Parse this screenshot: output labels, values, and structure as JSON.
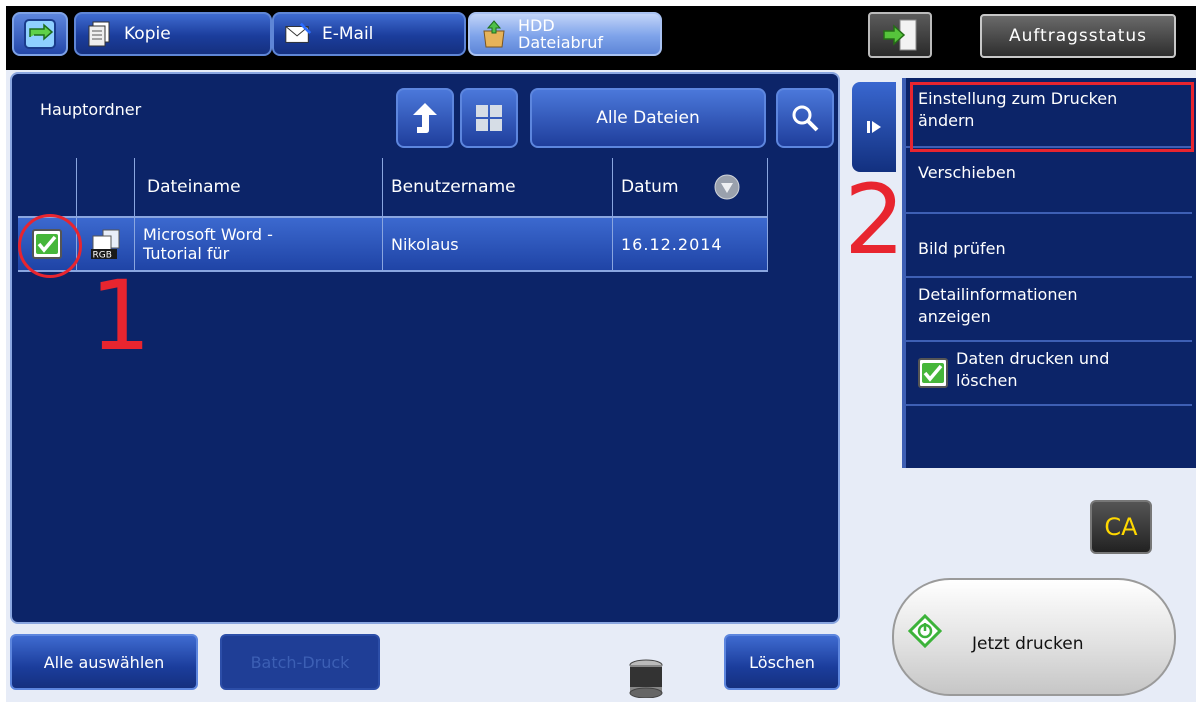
{
  "tabs": [
    {
      "label": "Kopie",
      "icon": "copy-icon"
    },
    {
      "label": "E-Mail",
      "icon": "email-icon"
    },
    {
      "label": "HDD\nDateiabruf",
      "line1": "HDD",
      "line2": "Dateiabruf",
      "icon": "hdd-retrieve-icon",
      "active": true
    }
  ],
  "job_status_label": "Auftragsstatus",
  "folder_label": "Hauptordner",
  "filter_label": "Alle Dateien",
  "table": {
    "columns": [
      "Dateiname",
      "Benutzername",
      "Datum"
    ],
    "rows": [
      {
        "checked": true,
        "file_type": "RGB",
        "filename_line1": "Microsoft Word -",
        "filename_line2": "Tutorial für",
        "user": "Nikolaus",
        "date": "16.12.2014"
      }
    ]
  },
  "bottom_buttons": {
    "select_all": "Alle auswählen",
    "batch_print": "Batch-Druck",
    "delete": "Löschen"
  },
  "actions": {
    "change_print_settings_line1": "Einstellung zum Drucken",
    "change_print_settings_line2": "ändern",
    "move": "Verschieben",
    "check_image": "Bild prüfen",
    "details_line1": "Detailinformationen",
    "details_line2": "anzeigen",
    "print_and_delete_line1": "Daten drucken und",
    "print_and_delete_line2": "löschen",
    "print_and_delete_checked": true
  },
  "ca_label": "CA",
  "print_now_label": "Jetzt drucken",
  "annotations": {
    "step1": "1",
    "step2": "2"
  },
  "colors": {
    "highlight": "#e8252f",
    "panel": "#0c2468",
    "button": "#1f44a6",
    "ca_text": "#ffd800"
  }
}
